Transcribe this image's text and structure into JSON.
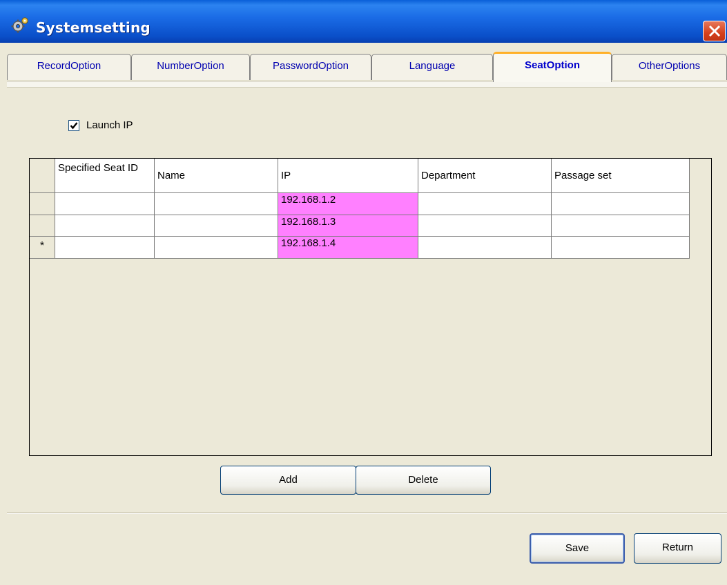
{
  "window": {
    "title": "Systemsetting",
    "icon": "gear-settings-icon",
    "close_icon": "close-icon"
  },
  "tabs": [
    {
      "label": "RecordOption",
      "active": false
    },
    {
      "label": "NumberOption",
      "active": false
    },
    {
      "label": "PasswordOption",
      "active": false
    },
    {
      "label": "Language",
      "active": false
    },
    {
      "label": "SeatOption",
      "active": true
    },
    {
      "label": "OtherOptions",
      "active": false
    }
  ],
  "launch_ip": {
    "label": "Launch IP",
    "checked": true
  },
  "grid": {
    "columns": [
      "Specified Seat ID",
      "Name",
      "IP",
      "Department",
      "Passage set"
    ],
    "rows": [
      {
        "marker": "",
        "cells": [
          "",
          "",
          "192.168.1.2",
          "",
          ""
        ]
      },
      {
        "marker": "",
        "cells": [
          "",
          "",
          "192.168.1.3",
          "",
          ""
        ]
      },
      {
        "marker": "*",
        "cells": [
          "",
          "",
          "192.168.1.4",
          "",
          ""
        ]
      }
    ],
    "highlight_color": "#FF80FF"
  },
  "grid_buttons": {
    "add": "Add",
    "delete": "Delete"
  },
  "footer_buttons": {
    "save": "Save",
    "return": "Return"
  }
}
